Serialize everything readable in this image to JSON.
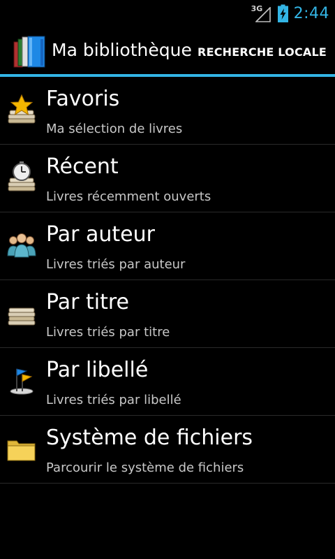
{
  "status_bar": {
    "network_label": "3G",
    "time": "2:44",
    "signal_icon": "signal-icon",
    "battery_icon": "battery-charging-icon",
    "clock_color": "#33b5e5"
  },
  "action_bar": {
    "title": "Ma bibliothèque",
    "action_label": "RECHERCHE LOCALE",
    "app_icon": "library-books-icon",
    "accent_color": "#33b5e5"
  },
  "list": {
    "items": [
      {
        "title": "Favoris",
        "subtitle": "Ma sélection de livres",
        "icon": "favorites-star-books-icon"
      },
      {
        "title": "Récent",
        "subtitle": "Livres récemment ouverts",
        "icon": "recent-clock-books-icon"
      },
      {
        "title": "Par auteur",
        "subtitle": "Livres triés par auteur",
        "icon": "authors-people-icon"
      },
      {
        "title": "Par titre",
        "subtitle": "Livres triés par titre",
        "icon": "titles-books-stack-icon"
      },
      {
        "title": "Par libellé",
        "subtitle": "Livres triés par libellé",
        "icon": "labels-flags-icon"
      },
      {
        "title": "Système de fichiers",
        "subtitle": "Parcourir le système de fichiers",
        "icon": "folder-icon"
      }
    ]
  }
}
